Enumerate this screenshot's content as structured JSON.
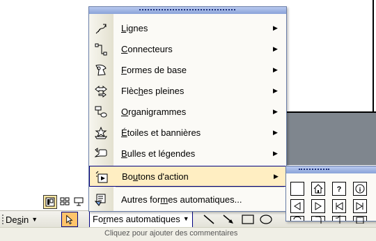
{
  "menu": {
    "items": [
      {
        "label": "Lignes",
        "accel": "L",
        "icon": "lines-icon",
        "has_submenu": true
      },
      {
        "label": "Connecteurs",
        "accel": "C",
        "icon": "connectors-icon",
        "has_submenu": true
      },
      {
        "label": "Formes de base",
        "accel": "F",
        "icon": "basic-shapes-icon",
        "has_submenu": true
      },
      {
        "label": "Flèches pleines",
        "accel": "h",
        "icon": "block-arrows-icon",
        "has_submenu": true
      },
      {
        "label": "Organigrammes",
        "accel": "O",
        "icon": "flowchart-icon",
        "has_submenu": true
      },
      {
        "label": "Étoiles et bannières",
        "accel": "É",
        "icon": "stars-banners-icon",
        "has_submenu": true
      },
      {
        "label": "Bulles et légendes",
        "accel": "B",
        "icon": "callouts-icon",
        "has_submenu": true
      },
      {
        "label": "Boutons d'action",
        "accel": "u",
        "icon": "action-buttons-icon",
        "has_submenu": true,
        "highlighted": true
      },
      {
        "label": "Autres formes automatiques...",
        "accel": "m",
        "icon": "more-autoshapes-icon",
        "has_submenu": false
      }
    ]
  },
  "submenu": {
    "buttons": [
      "action-custom-icon",
      "action-home-icon",
      "action-help-icon",
      "action-information-icon",
      "action-back-icon",
      "action-forward-icon",
      "action-beginning-icon",
      "action-end-icon",
      "action-return-icon",
      "action-document-icon",
      "action-sound-icon",
      "action-movie-icon"
    ]
  },
  "toolbar": {
    "dessin_label": "Dessin",
    "dessin_accel": "s",
    "formes_label": "Formes automatiques",
    "formes_accel": "r"
  },
  "status": {
    "text": "Cliquez pour ajouter des commentaires"
  },
  "colors": {
    "highlight": "#ffeec2",
    "highlight_border": "#000080",
    "menu_title": "#8aa3d8",
    "pointer_active": "#ffc46b"
  }
}
